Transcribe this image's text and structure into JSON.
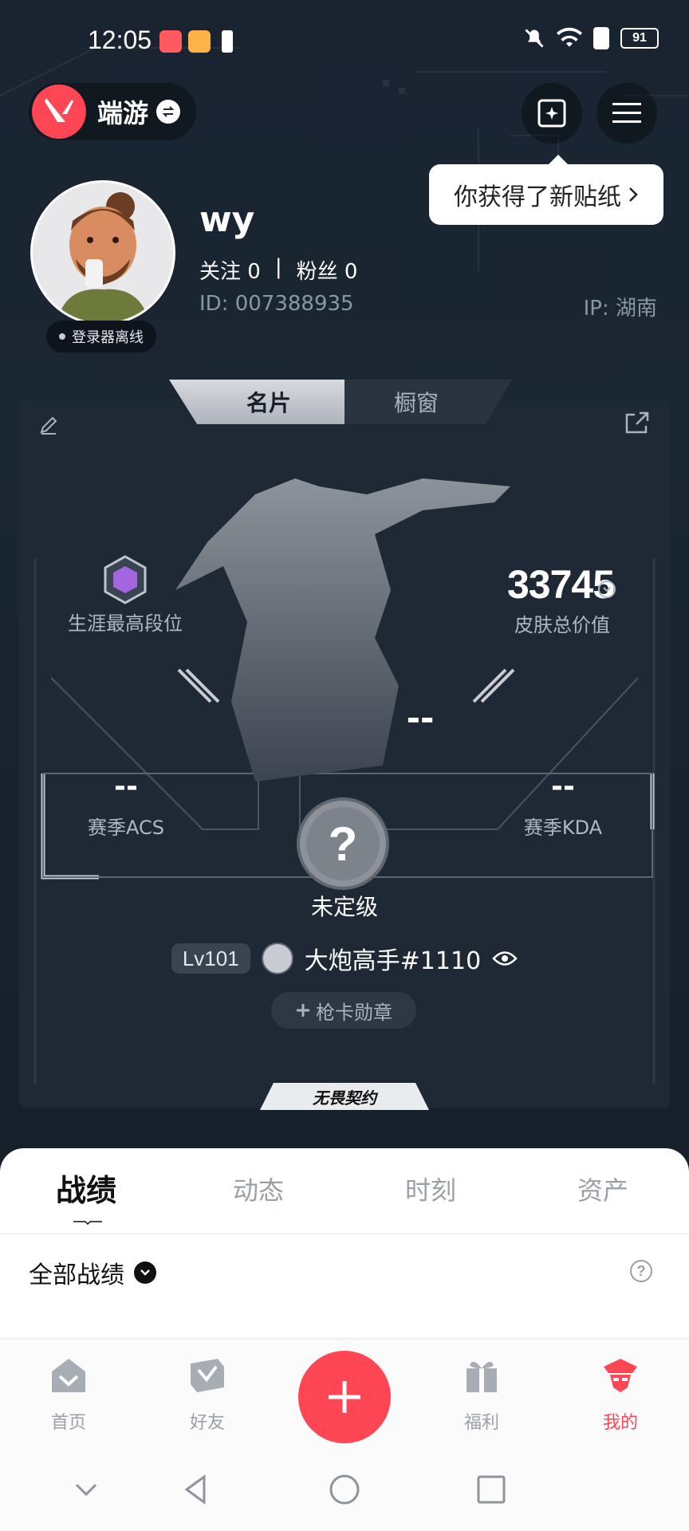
{
  "status_bar": {
    "time": "12:05",
    "battery": "91"
  },
  "header": {
    "app_name": "端游",
    "sticker_tip": "你获得了新贴纸",
    "colors": {
      "brand": "#ff4655"
    }
  },
  "profile": {
    "username": "wy",
    "following_label": "关注",
    "following_count": "0",
    "followers_label": "粉丝",
    "followers_count": "0",
    "separator": "|",
    "id_text": "ID:  007388935",
    "ip_text": "IP:  湖南",
    "status": "登录器离线"
  },
  "card": {
    "tabs": [
      "名片",
      "橱窗"
    ],
    "active_tab": "名片",
    "career_rank_label": "生涯最高段位",
    "skin_value": "33745",
    "skin_value_label": "皮肤总价值",
    "center_dash": "--",
    "season_acs_value": "--",
    "season_acs_label": "赛季ACS",
    "season_kda_value": "--",
    "season_kda_label": "赛季KDA",
    "rank_label": "未定级",
    "level": "Lv101",
    "player_tag": "大炮高手#1110",
    "medal_button": "枪卡勋章",
    "brand_text": "无畏契约"
  },
  "content_tabs": {
    "items": [
      "战绩",
      "动态",
      "时刻",
      "资产"
    ],
    "active": "战绩"
  },
  "filter": {
    "label": "全部战绩"
  },
  "bottom_nav": {
    "items": [
      {
        "label": "首页",
        "icon": "home-icon"
      },
      {
        "label": "好友",
        "icon": "friends-icon"
      },
      {
        "label": "",
        "icon": "plus-icon"
      },
      {
        "label": "福利",
        "icon": "gift-icon"
      },
      {
        "label": "我的",
        "icon": "profile-icon"
      }
    ],
    "active": "我的"
  }
}
